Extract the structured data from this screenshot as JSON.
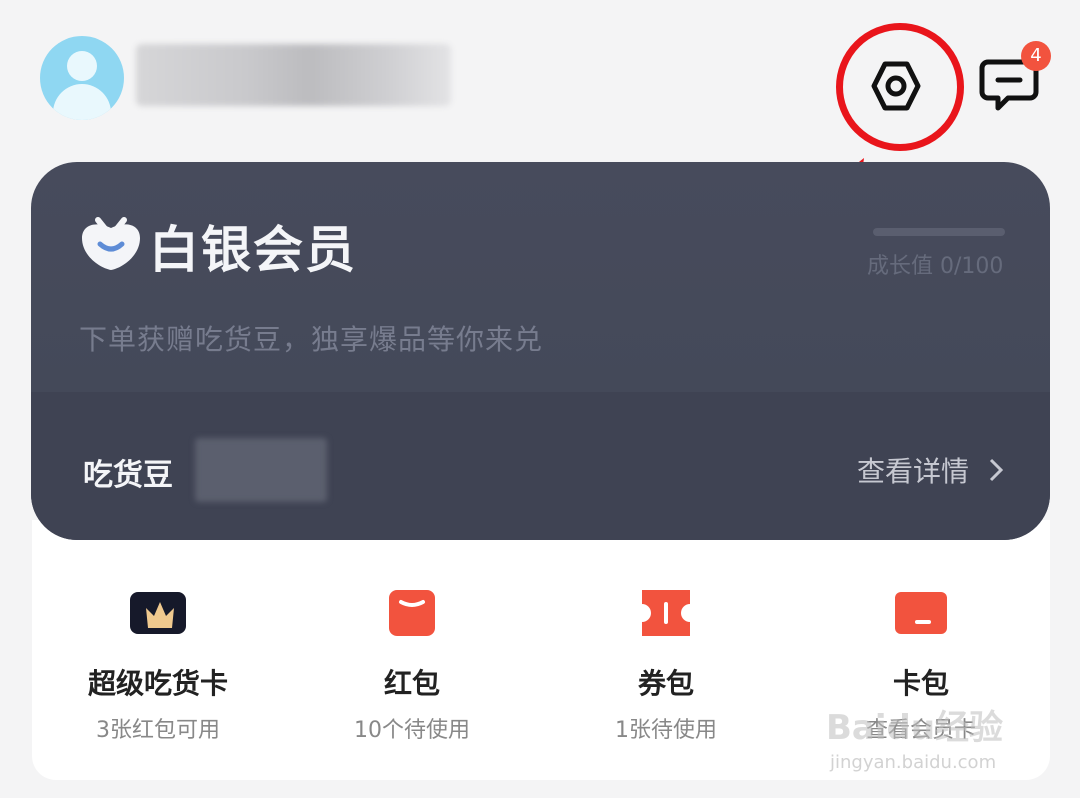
{
  "header": {
    "message_badge_count": "4",
    "settings_icon": "settings-hexagon-icon",
    "message_icon": "chat-bubble-icon"
  },
  "member_card": {
    "title": "白银会员",
    "growth_label": "成长值 0/100",
    "growth_progress": 0,
    "description": "下单获赠吃货豆，独享爆品等你来兑",
    "beans_label": "吃货豆",
    "details_link": "查看详情"
  },
  "menu": [
    {
      "label": "超级吃货卡",
      "sub": "3张红包可用",
      "icon": "crown-card-icon"
    },
    {
      "label": "红包",
      "sub": "10个待使用",
      "icon": "red-packet-icon"
    },
    {
      "label": "券包",
      "sub": "1张待使用",
      "icon": "coupon-icon"
    },
    {
      "label": "卡包",
      "sub": "查看会员卡",
      "icon": "card-wallet-icon"
    }
  ],
  "watermark": {
    "text": "Baidu经验",
    "sub": "jingyan.baidu.com"
  },
  "colors": {
    "accent_red": "#e9151b",
    "badge": "#f2533e",
    "card_bg": "#474b5c",
    "icon_orange": "#f2533e"
  }
}
